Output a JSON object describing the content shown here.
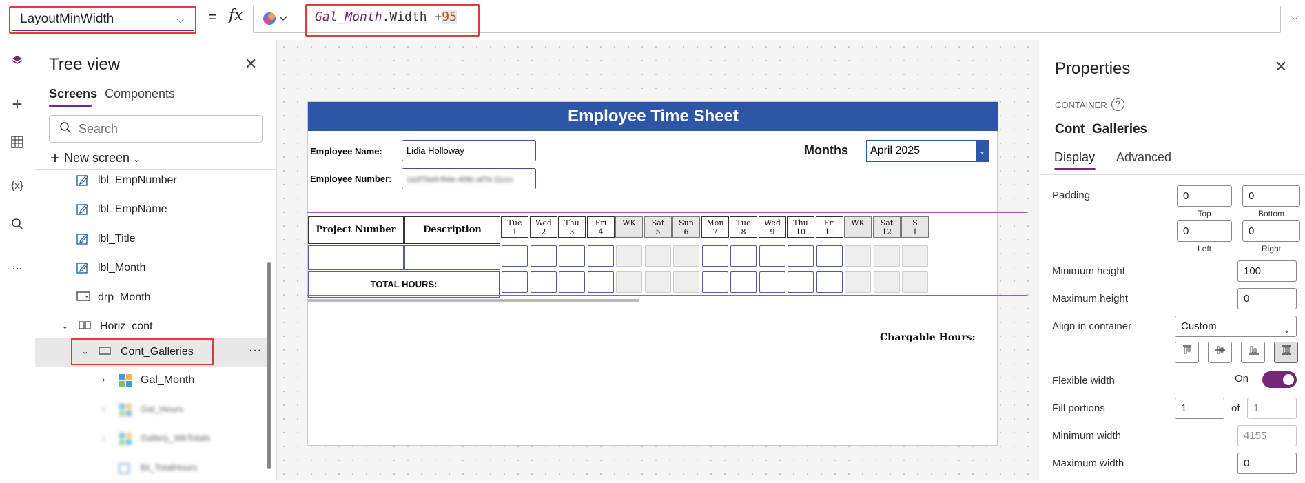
{
  "formula_bar": {
    "property": "LayoutMinWidth",
    "equals": "=",
    "fx": "fx",
    "formula_var": "Gal_Month",
    "formula_mid": ".Width +",
    "formula_num": "95"
  },
  "rail": {
    "icons": [
      "layers-icon",
      "plus-icon",
      "table-icon",
      "variables-icon",
      "search-icon",
      "more-icon"
    ],
    "variables_glyph": "{x}",
    "more_glyph": "..."
  },
  "tree": {
    "title": "Tree view",
    "tabs": [
      "Screens",
      "Components"
    ],
    "search_placeholder": "Search",
    "new_screen": "New screen",
    "items": [
      {
        "label": "lbl_EmpNumber",
        "icon": "edit-label-icon"
      },
      {
        "label": "lbl_EmpName",
        "icon": "edit-label-icon"
      },
      {
        "label": "lbl_Title",
        "icon": "edit-label-icon"
      },
      {
        "label": "lbl_Month",
        "icon": "edit-label-icon"
      },
      {
        "label": "drp_Month",
        "icon": "dropdown-icon"
      },
      {
        "label": "Horiz_cont",
        "icon": "horizontal-container-icon"
      },
      {
        "label": "Cont_Galleries",
        "icon": "container-icon"
      },
      {
        "label": "Gal_Month",
        "icon": "gallery-icon"
      },
      {
        "label": "Gal_Hours",
        "icon": "gallery-icon"
      },
      {
        "label": "Gallery_WkTotals",
        "icon": "gallery-icon"
      },
      {
        "label": "lbl_TotalHours",
        "icon": "label-icon"
      }
    ],
    "more_glyph": "···"
  },
  "canvas": {
    "header": "Employee Time Sheet",
    "emp_name_label": "Employee Name:",
    "emp_name_value": "Lidia Holloway",
    "emp_number_label": "Employee Number:",
    "emp_number_value": "1a2f7be9-f94e-408c-af7e-11ccc",
    "months_label": "Months",
    "month_value": "April 2025",
    "project_number": "Project Number",
    "description": "Description",
    "total_hours": "TOTAL HOURS:",
    "chargable": "Chargable Hours:",
    "days": [
      {
        "d": "Tue",
        "n": "1",
        "we": false
      },
      {
        "d": "Wed",
        "n": "2",
        "we": false
      },
      {
        "d": "Thu",
        "n": "3",
        "we": false
      },
      {
        "d": "Fri",
        "n": "4",
        "we": false
      },
      {
        "d": "WK",
        "n": "",
        "we": true
      },
      {
        "d": "Sat",
        "n": "5",
        "we": true
      },
      {
        "d": "Sun",
        "n": "6",
        "we": true
      },
      {
        "d": "Mon",
        "n": "7",
        "we": false
      },
      {
        "d": "Tue",
        "n": "8",
        "we": false
      },
      {
        "d": "Wed",
        "n": "9",
        "we": false
      },
      {
        "d": "Thu",
        "n": "10",
        "we": false
      },
      {
        "d": "Fri",
        "n": "11",
        "we": false
      },
      {
        "d": "WK",
        "n": "",
        "we": true
      },
      {
        "d": "Sat",
        "n": "12",
        "we": true
      },
      {
        "d": "S",
        "n": "1",
        "we": true
      }
    ]
  },
  "properties": {
    "title": "Properties",
    "control_type": "CONTAINER",
    "control_name": "Cont_Galleries",
    "tabs": [
      "Display",
      "Advanced"
    ],
    "padding_label": "Padding",
    "padding": {
      "top": "0",
      "bottom": "0",
      "left": "0",
      "right": "0"
    },
    "padding_sub": {
      "top": "Top",
      "bottom": "Bottom",
      "left": "Left",
      "right": "Right"
    },
    "min_height_label": "Minimum height",
    "min_height": "100",
    "max_height_label": "Maximum height",
    "max_height": "0",
    "align_label": "Align in container",
    "align_value": "Custom",
    "flex_width_label": "Flexible width",
    "flex_width_state": "On",
    "fill_label": "Fill portions",
    "fill_value": "1",
    "fill_of": "of",
    "fill_total": "1",
    "min_width_label": "Minimum width",
    "min_width": "4155",
    "max_width_label": "Maximum width",
    "max_width": "0"
  },
  "colors": {
    "accent": "#742774",
    "header_blue": "#2e56a6",
    "highlight": "#e0393e"
  }
}
